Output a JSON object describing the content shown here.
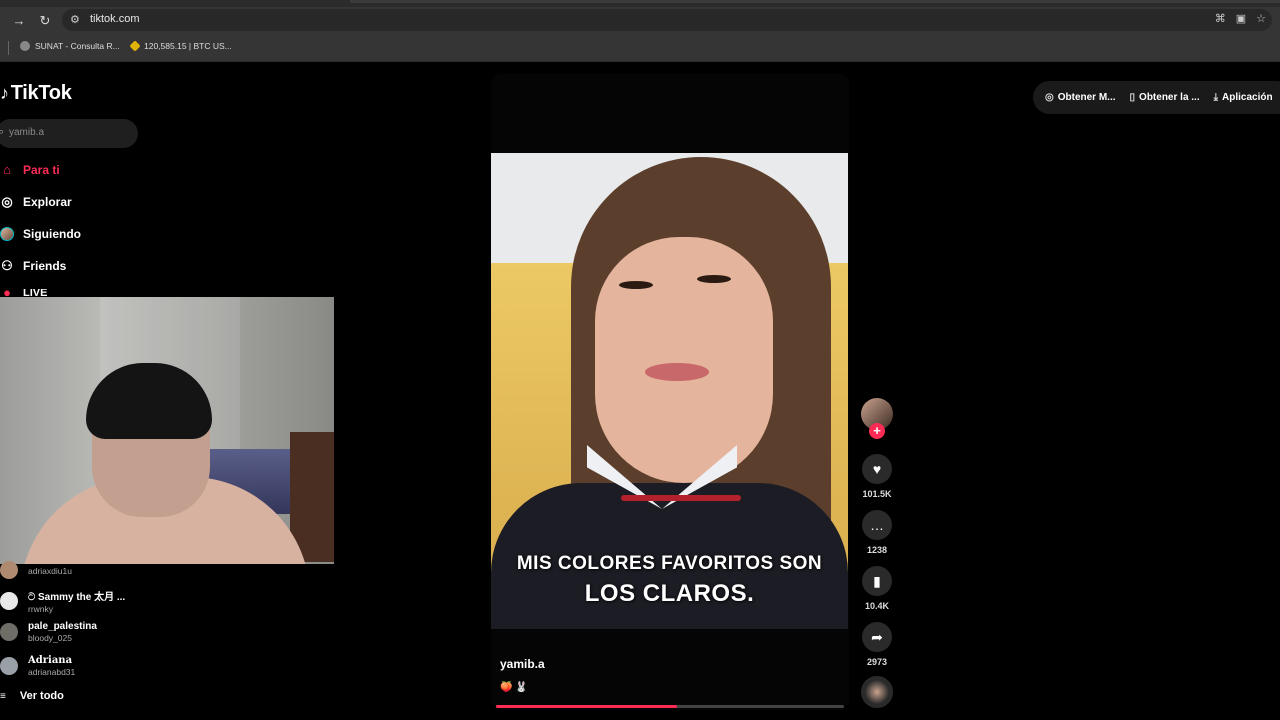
{
  "browser": {
    "url": "tiktok.com",
    "bookmarks": [
      {
        "label": "SUNAT - Consulta R..."
      },
      {
        "label": "120,585.15 | BTC US..."
      }
    ]
  },
  "tiktok": {
    "logo": "TikTok",
    "search_placeholder": "yamib.a",
    "nav": [
      {
        "label": "Para ti",
        "icon": "home-icon"
      },
      {
        "label": "Explorar",
        "icon": "compass-icon"
      },
      {
        "label": "Siguiendo",
        "icon": "avatar"
      },
      {
        "label": "Friends",
        "icon": "friends-icon"
      },
      {
        "label": "LIVE",
        "icon": "live-icon"
      }
    ],
    "following": [
      {
        "name": "",
        "handle": "adriaxdiu1u"
      },
      {
        "name": "ට Sammy the 太月 ...",
        "handle": "rrwnky"
      },
      {
        "name": "pale_palestina",
        "handle": "bloody_025"
      },
      {
        "name": "Adriana",
        "handle": "adrianabd31"
      }
    ],
    "see_all": "Ver todo",
    "top_actions": [
      {
        "label": "Obtener M...",
        "icon": "coin-icon"
      },
      {
        "label": "Obtener la ...",
        "icon": "phone-icon"
      },
      {
        "label": "Aplicación",
        "icon": "download-icon"
      }
    ],
    "video": {
      "caption_line1": "MIS COLORES FAVORITOS SON",
      "caption_line2": "LOS CLAROS.",
      "author": "yamib.a",
      "description": "🍑 🐰",
      "progress_pct": 52,
      "likes": "101.5K",
      "comments": "1238",
      "saves": "10.4K",
      "shares": "2973"
    }
  }
}
